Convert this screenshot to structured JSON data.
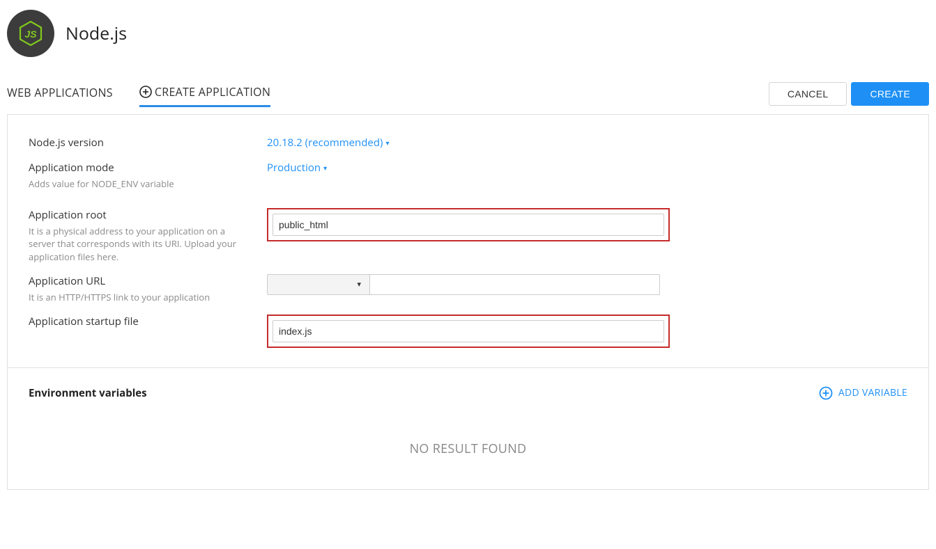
{
  "header": {
    "title": "Node.js"
  },
  "tabs": {
    "web_applications": "WEB APPLICATIONS",
    "create_application": "CREATE APPLICATION"
  },
  "actions": {
    "cancel": "CANCEL",
    "create": "CREATE"
  },
  "form": {
    "node_version": {
      "label": "Node.js version",
      "value": "20.18.2 (recommended)"
    },
    "app_mode": {
      "label": "Application mode",
      "hint": "Adds value for NODE_ENV variable",
      "value": "Production"
    },
    "app_root": {
      "label": "Application root",
      "hint": "It is a physical address to your application on a server that corresponds with its URI. Upload your application files here.",
      "value": "public_html"
    },
    "app_url": {
      "label": "Application URL",
      "hint": "It is an HTTP/HTTPS link to your application",
      "value": ""
    },
    "startup_file": {
      "label": "Application startup file",
      "value": "index.js"
    }
  },
  "envvars": {
    "title": "Environment variables",
    "add_label": "ADD VARIABLE",
    "empty": "NO RESULT FOUND"
  }
}
